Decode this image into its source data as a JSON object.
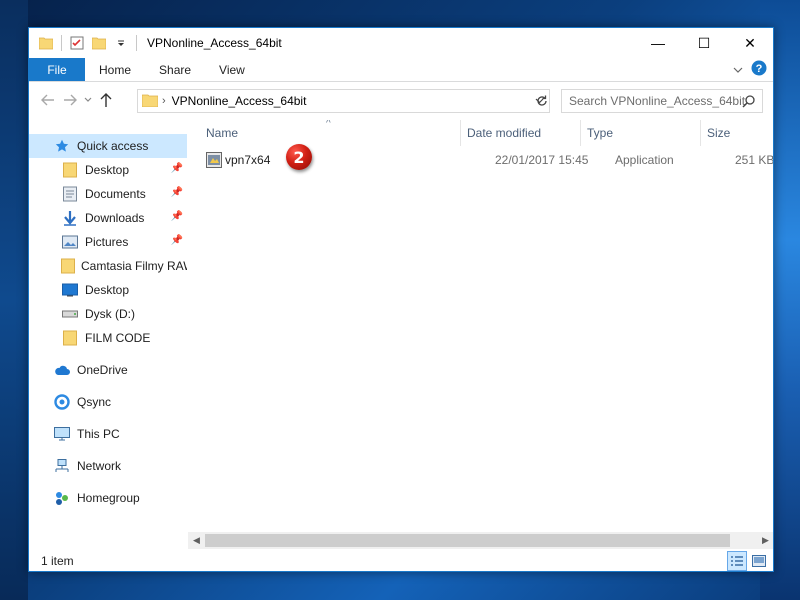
{
  "window": {
    "title": "VPNonline_Access_64bit",
    "controls": {
      "minimize": "—",
      "maximize": "☐",
      "close": "✕"
    }
  },
  "ribbon": {
    "tabs": [
      "File",
      "Home",
      "Share",
      "View"
    ],
    "expand_icon": "chevron-down-icon",
    "help_icon": "help-icon"
  },
  "address": {
    "path": "VPNonline_Access_64bit",
    "search_placeholder": "Search VPNonline_Access_64bit"
  },
  "nav": {
    "items": [
      {
        "label": "Quick access",
        "icon": "star-icon",
        "selected": true,
        "pinned": false
      },
      {
        "label": "Desktop",
        "icon": "folder-icon",
        "pinned": true
      },
      {
        "label": "Documents",
        "icon": "documents-icon",
        "pinned": true
      },
      {
        "label": "Downloads",
        "icon": "download-arrow-icon",
        "pinned": true
      },
      {
        "label": "Pictures",
        "icon": "pictures-icon",
        "pinned": true
      },
      {
        "label": "Camtasia Filmy RAW",
        "icon": "folder-icon",
        "pinned": false
      },
      {
        "label": "Desktop",
        "icon": "desktop-icon",
        "pinned": false
      },
      {
        "label": "Dysk (D:)",
        "icon": "drive-icon",
        "pinned": false
      },
      {
        "label": "FILM CODE",
        "icon": "folder-icon",
        "pinned": false
      },
      {
        "label": "OneDrive",
        "icon": "cloud-icon",
        "pinned": false
      },
      {
        "label": "Qsync",
        "icon": "sync-icon",
        "pinned": false
      },
      {
        "label": "This PC",
        "icon": "computer-icon",
        "pinned": false
      },
      {
        "label": "Network",
        "icon": "network-icon",
        "pinned": false
      },
      {
        "label": "Homegroup",
        "icon": "homegroup-icon",
        "pinned": false
      }
    ]
  },
  "columns": [
    "Name",
    "Date modified",
    "Type",
    "Size"
  ],
  "files": [
    {
      "name": "vpn7x64",
      "date": "22/01/2017 15:45",
      "type": "Application",
      "size": "251 KB",
      "icon": "application-icon"
    }
  ],
  "annotation": {
    "step_number": "2"
  },
  "status": {
    "count": "1 item"
  },
  "colors": {
    "accent": "#1979ca",
    "selection": "#cce8ff",
    "marker": "#d11f14"
  }
}
